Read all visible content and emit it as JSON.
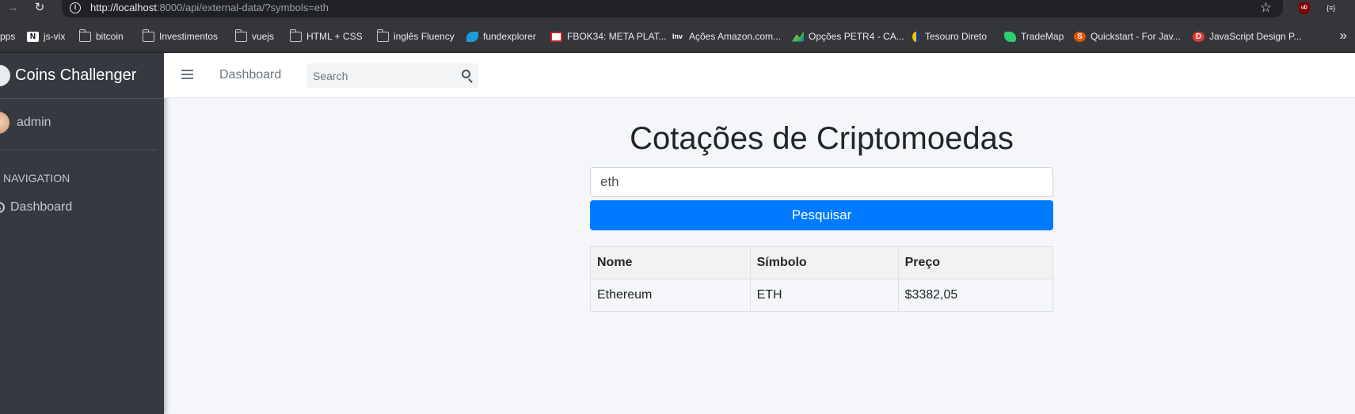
{
  "browser": {
    "url_host": "http://localhost",
    "url_rest": ":8000/api/external-data/?symbols=eth",
    "ext_ublock": "uD",
    "ext_json": "{≡}",
    "bookmarks": [
      {
        "label": "pps",
        "icon": "apps-icon"
      },
      {
        "label": "js-vix",
        "icon": "notion-icon"
      },
      {
        "label": "bitcoin",
        "icon": "folder-icon"
      },
      {
        "label": "Investimentos",
        "icon": "folder-icon"
      },
      {
        "label": "vuejs",
        "icon": "folder-icon"
      },
      {
        "label": "HTML + CSS",
        "icon": "folder-icon"
      },
      {
        "label": "inglês Fluency",
        "icon": "folder-icon"
      },
      {
        "label": "fundexplorer",
        "icon": "fundexplorer-icon"
      },
      {
        "label": "FBOK34: META PLAT...",
        "icon": "status-invest-icon"
      },
      {
        "label": "Ações Amazon.com...",
        "icon": "investing-icon"
      },
      {
        "label": "Opções PETR4 - CA...",
        "icon": "chart-icon"
      },
      {
        "label": "Tesouro Direto",
        "icon": "tesouro-icon"
      },
      {
        "label": "TradeMap",
        "icon": "trademap-icon"
      },
      {
        "label": "Quickstart - For Jav...",
        "icon": "swagger-icon"
      },
      {
        "label": "JavaScript Design P...",
        "icon": "dofactory-icon"
      }
    ]
  },
  "sidebar": {
    "brand": "Coins Challenger",
    "user": "admin",
    "nav_header": "N NAVIGATION",
    "dashboard": "Dashboard"
  },
  "topbar": {
    "dashboard": "Dashboard",
    "search_placeholder": "Search"
  },
  "main": {
    "title": "Cotações de Criptomoedas",
    "input_value": "eth",
    "button_label": "Pesquisar",
    "table": {
      "headers": [
        "Nome",
        "Símbolo",
        "Preço"
      ],
      "rows": [
        [
          "Ethereum",
          "ETH",
          "$3382,05"
        ]
      ]
    }
  },
  "colors": {
    "sidebar": "#343a40",
    "primary": "#007bff",
    "background": "#f4f6f9"
  }
}
